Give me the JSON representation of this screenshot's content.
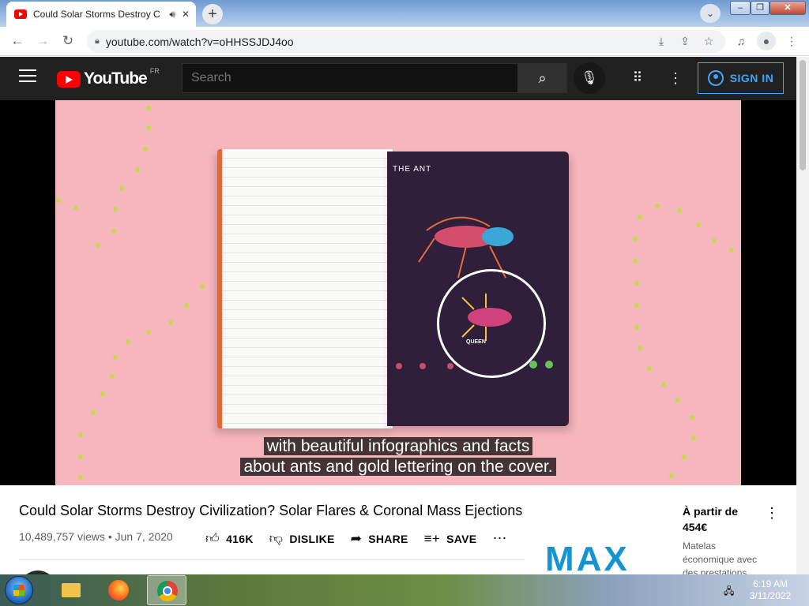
{
  "browser": {
    "tab": {
      "title": "Could Solar Storms Destroy C",
      "audio_icon": "speaker-icon",
      "close_icon": "close-icon"
    },
    "new_tab_label": "+",
    "url": "youtube.com/watch?v=oHHSSJDJ4oo"
  },
  "youtube": {
    "logo_text": "YouTube",
    "region": "FR",
    "search_placeholder": "Search",
    "sign_in_label": "SIGN IN",
    "accent": "#3ea6ff",
    "brand": "#ff0000"
  },
  "video": {
    "overlay_heading": "THE ANT",
    "overlay_queen": "QUEEN",
    "subtitle_line1": "with beautiful infographics and facts",
    "subtitle_line2": "about ants and gold lettering on the cover.",
    "title": "Could Solar Storms Destroy Civilization? Solar Flares & Coronal Mass Ejections",
    "views_date": "10,489,757 views • Jun 7, 2020",
    "likes": "416K",
    "dislike_label": "DISLIKE",
    "share_label": "SHARE",
    "save_label": "SAVE"
  },
  "ad": {
    "price_label": "À partir de",
    "price": "454€",
    "description": "Matelas économique avec des prestations",
    "logo": "MAX"
  },
  "taskbar": {
    "time": "6:19 AM",
    "date": "3/11/2022"
  }
}
